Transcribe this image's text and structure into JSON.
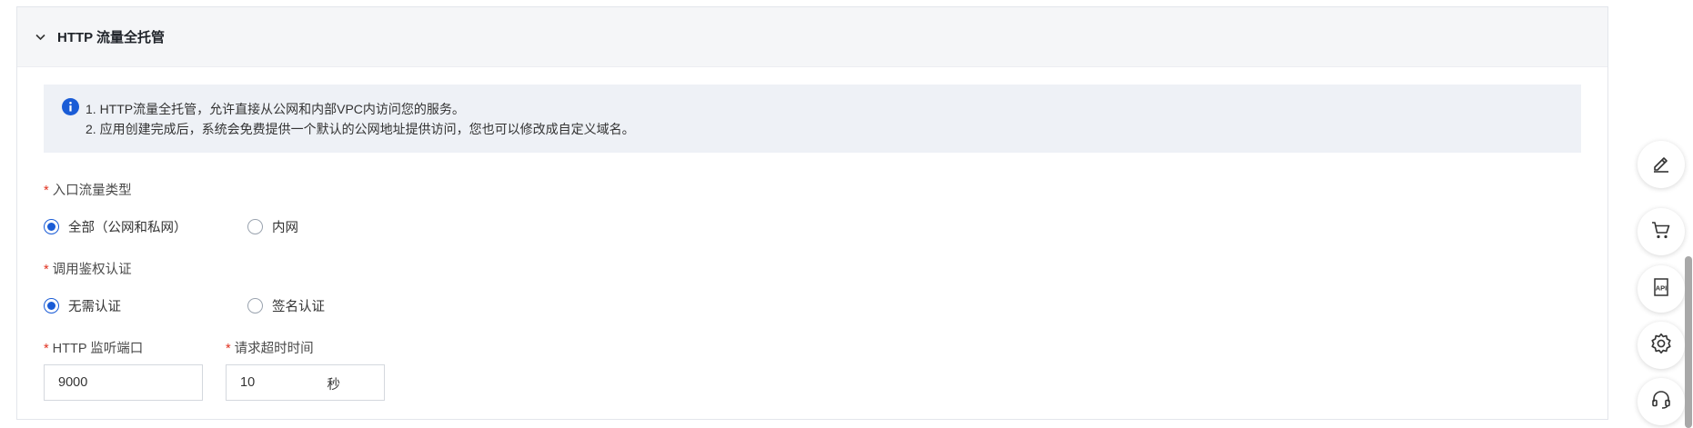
{
  "section": {
    "title": "HTTP 流量全托管"
  },
  "notice": {
    "lines": [
      "1. HTTP流量全托管，允许直接从公网和内部VPC内访问您的服务。",
      "2. 应用创建完成后，系统会免费提供一个默认的公网地址提供访问，您也可以修改成自定义域名。"
    ]
  },
  "ingress": {
    "required_mark": "*",
    "label": "入口流量类型",
    "options": [
      "全部（公网和私网）",
      "内网"
    ],
    "selected": "全部（公网和私网）"
  },
  "auth": {
    "required_mark": "*",
    "label": "调用鉴权认证",
    "options": [
      "无需认证",
      "签名认证"
    ],
    "selected": "无需认证"
  },
  "port": {
    "required_mark": "*",
    "label": "HTTP 监听端口",
    "value": "9000"
  },
  "timeout": {
    "required_mark": "*",
    "label": "请求超时时间",
    "value": "10",
    "unit": "秒"
  },
  "sidebar": {
    "icons": [
      "edit-icon",
      "cart-icon",
      "api-doc-icon",
      "settings-icon",
      "support-headset-icon"
    ]
  },
  "colors": {
    "accent": "#1a5cd6",
    "required": "#e0301e",
    "notice_bg": "#eef1f6"
  }
}
